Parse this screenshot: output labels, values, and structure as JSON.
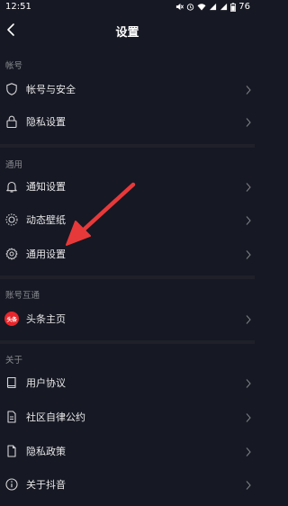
{
  "status_bar": {
    "time": "12:51",
    "battery": "76"
  },
  "header": {
    "title": "设置"
  },
  "sections": {
    "account": {
      "title": "帐号",
      "items": [
        {
          "label": "帐号与安全",
          "icon": "shield-icon"
        },
        {
          "label": "隐私设置",
          "icon": "lock-icon"
        }
      ]
    },
    "general": {
      "title": "通用",
      "items": [
        {
          "label": "通知设置",
          "icon": "bell-icon"
        },
        {
          "label": "动态壁纸",
          "icon": "wallpaper-icon"
        },
        {
          "label": "通用设置",
          "icon": "gear-icon"
        }
      ]
    },
    "linked": {
      "title": "账号互通",
      "items": [
        {
          "label": "头条主页",
          "icon": "toutiao-icon",
          "badge": "头条"
        }
      ]
    },
    "about": {
      "title": "关于",
      "items": [
        {
          "label": "用户协议",
          "icon": "book-icon"
        },
        {
          "label": "社区自律公约",
          "icon": "document-icon"
        },
        {
          "label": "隐私政策",
          "icon": "file-icon"
        },
        {
          "label": "关于抖音",
          "icon": "info-icon"
        }
      ]
    }
  },
  "colors": {
    "background": "#161823",
    "divider": "#1f2029",
    "annotation_arrow": "#e8393a",
    "toutiao_badge": "#e8262b"
  }
}
